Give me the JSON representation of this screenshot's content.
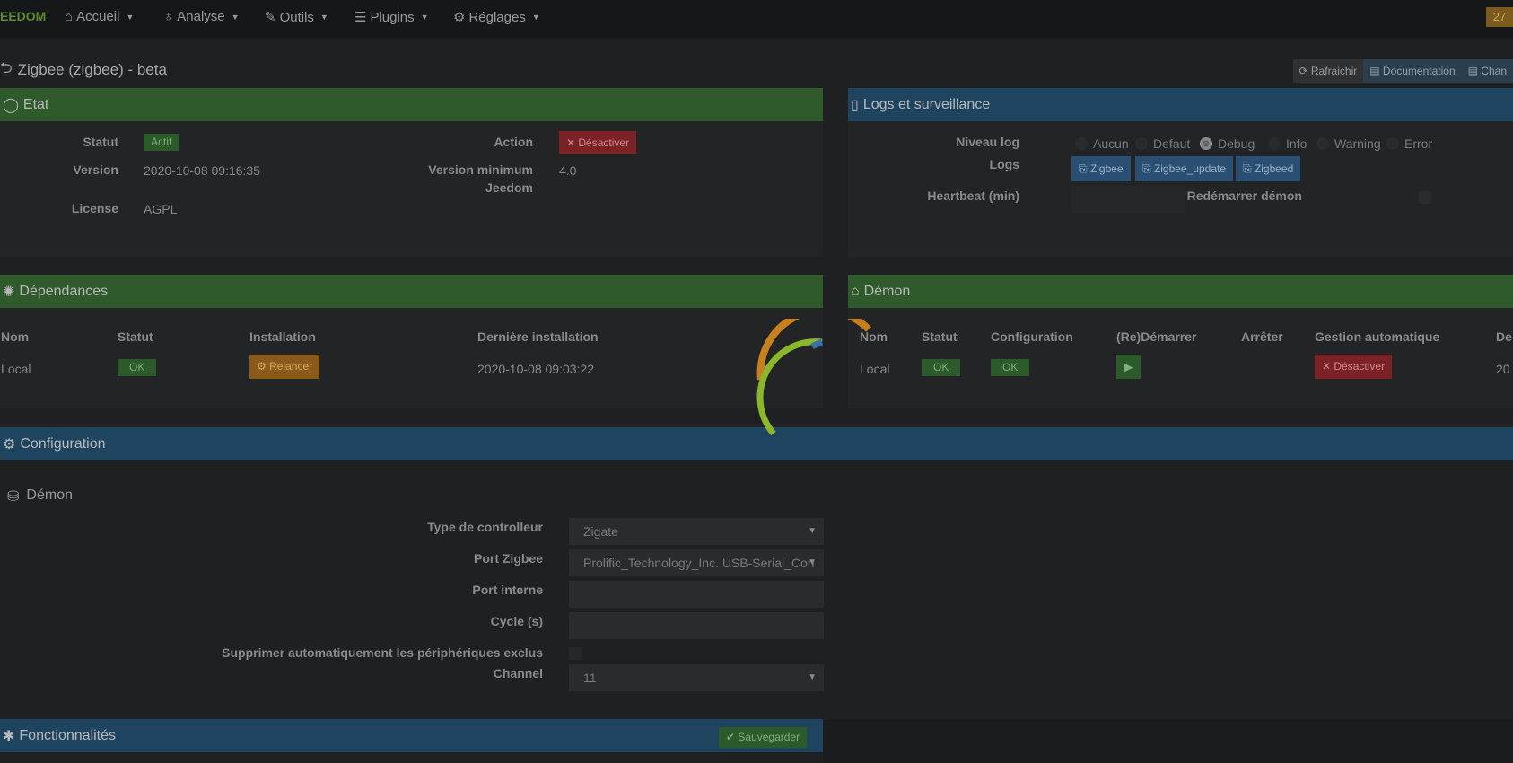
{
  "navbar": {
    "logo": "EEDOM",
    "items": [
      {
        "icon": "home-icon",
        "label": "Accueil"
      },
      {
        "icon": "stethoscope-icon",
        "label": "Analyse"
      },
      {
        "icon": "wrench-icon",
        "label": "Outils"
      },
      {
        "icon": "list-icon",
        "label": "Plugins"
      },
      {
        "icon": "gear-icon",
        "label": "Réglages"
      }
    ],
    "notification_count": "27"
  },
  "page": {
    "title": "Zigbee (zigbee) - beta",
    "buttons": {
      "refresh": "Rafraichir",
      "documentation": "Documentation",
      "changelog": "Chan"
    }
  },
  "etat": {
    "title": "Etat",
    "statut_label": "Statut",
    "statut_value": "Actif",
    "action_label": "Action",
    "action_button": "Désactiver",
    "version_label": "Version",
    "version_value": "2020-10-08 09:16:35",
    "version_min_label_1": "Version minimum",
    "version_min_label_2": "Jeedom",
    "version_min_value": "4.0",
    "license_label": "License",
    "license_value": "AGPL"
  },
  "logs": {
    "title": "Logs et surveillance",
    "niveau_label": "Niveau log",
    "levels": [
      "Aucun",
      "Defaut",
      "Debug",
      "Info",
      "Warning",
      "Error"
    ],
    "selected_level": "Debug",
    "logs_label": "Logs",
    "log_buttons": [
      "Zigbee",
      "Zigbee_update",
      "Zigbeed"
    ],
    "heartbeat_label": "Heartbeat (min)",
    "restart_label": "Redémarrer démon"
  },
  "dependances": {
    "title": "Dépendances",
    "headers": [
      "Nom",
      "Statut",
      "Installation",
      "Dernière installation"
    ],
    "row": {
      "nom": "Local",
      "statut": "OK",
      "installation": "Relancer",
      "derniere": "2020-10-08 09:03:22"
    }
  },
  "demon": {
    "title": "Démon",
    "headers": [
      "Nom",
      "Statut",
      "Configuration",
      "(Re)Démarrer",
      "Arrêter",
      "Gestion automatique",
      "De"
    ],
    "row": {
      "nom": "Local",
      "statut": "OK",
      "configuration": "OK",
      "gestion": "Désactiver",
      "last": "20"
    }
  },
  "configuration": {
    "title": "Configuration",
    "section": "Démon",
    "fields": {
      "type_label": "Type de controlleur",
      "type_value": "Zigate",
      "port_label": "Port Zigbee",
      "port_value": "Prolific_Technology_Inc. USB-Serial_Con",
      "port_interne_label": "Port interne",
      "cycle_label": "Cycle (s)",
      "supprimer_label": "Supprimer automatiquement les périphériques exclus",
      "channel_label": "Channel",
      "channel_value": "11"
    }
  },
  "fonctionnalites": {
    "title": "Fonctionnalités",
    "save_button": "Sauvegarder"
  },
  "colors": {
    "green_header": "#2f5a2c",
    "blue_header": "#1f4460",
    "spinner_orange": "#c8801f",
    "spinner_green": "#8ab82a",
    "spinner_blue": "#3a6ea8"
  }
}
